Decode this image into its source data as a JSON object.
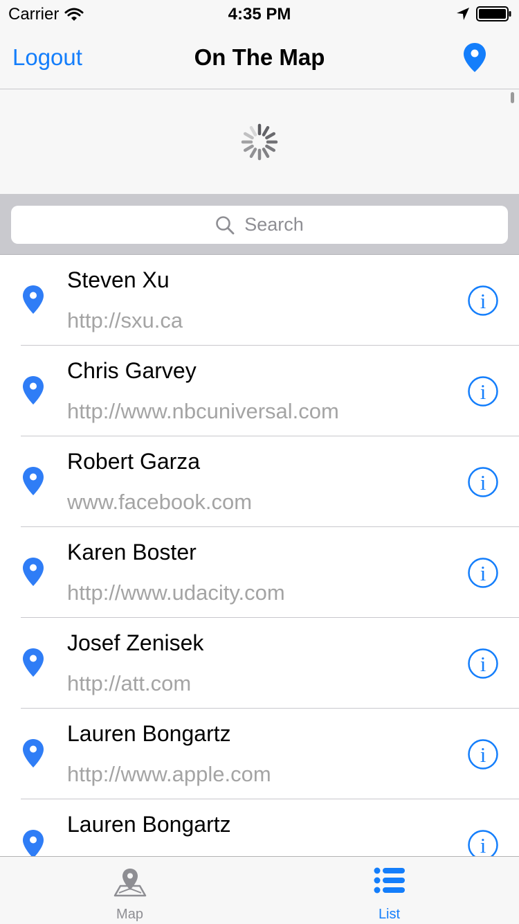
{
  "status_bar": {
    "carrier": "Carrier",
    "time": "4:35 PM"
  },
  "nav": {
    "left_button": "Logout",
    "title": "On The Map",
    "right_icon": "location-pin-icon"
  },
  "search": {
    "placeholder": "Search"
  },
  "students": [
    {
      "name": "Steven Xu",
      "url": "http://sxu.ca"
    },
    {
      "name": "Chris Garvey",
      "url": "http://www.nbcuniversal.com"
    },
    {
      "name": "Robert Garza",
      "url": "www.facebook.com"
    },
    {
      "name": "Karen Boster",
      "url": "http://www.udacity.com"
    },
    {
      "name": "Josef Zenisek",
      "url": "http://att.com"
    },
    {
      "name": "Lauren Bongartz",
      "url": "http://www.apple.com"
    },
    {
      "name": "Lauren Bongartz",
      "url": ""
    }
  ],
  "tabs": [
    {
      "label": "Map",
      "icon": "map-icon",
      "selected": false
    },
    {
      "label": "List",
      "icon": "list-icon",
      "selected": true
    }
  ],
  "colors": {
    "accent": "#147efb",
    "pin": "#2f7df6",
    "inactive": "#8e8e93"
  }
}
